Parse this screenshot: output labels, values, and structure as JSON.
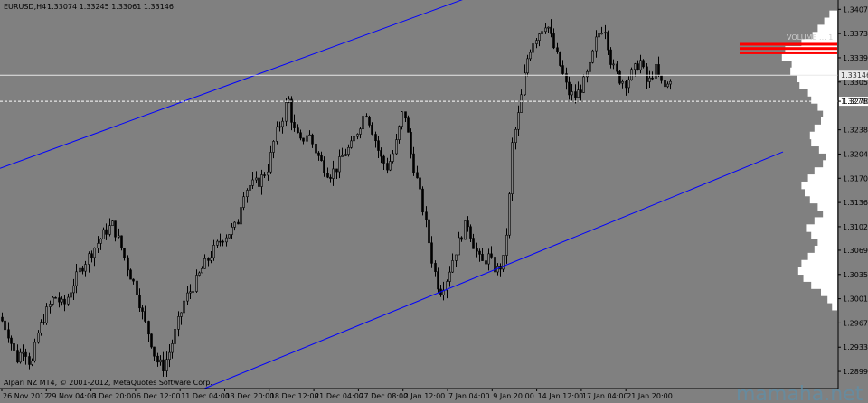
{
  "header": {
    "symbol": "EURUSD,H4",
    "ohlc": "1.33074 1.33245 1.33061 1.33146"
  },
  "copyright": "Alpari NZ MT4, © 2001-2012, MetaQuotes Software Corp.",
  "watermark": "mamaha.net",
  "colors": {
    "background": "#808080",
    "candle": "#000000",
    "channel": "#0000ff",
    "price_line": "#e8e8e8",
    "level_line": "#ffffff",
    "volume_profile": "#ffffff",
    "poc": "#ff0000",
    "axis_panel": "#808080"
  },
  "chart_data": {
    "type": "candlestick",
    "title": "",
    "xlabel": "",
    "ylabel": "",
    "ylim": [
      1.2875,
      1.3415
    ],
    "y_ticks": [
      "1.34070",
      "1.33730",
      "1.33390",
      "1.33050",
      "1.32780",
      "1.32380",
      "1.32040",
      "1.31700",
      "1.31360",
      "1.31020",
      "1.30690",
      "1.30350",
      "1.30010",
      "1.29670",
      "1.29330",
      "1.28990"
    ],
    "x_labels": [
      "26 Nov 2012",
      "29 Nov 04:00",
      "3 Dec 20:00",
      "6 Dec 12:00",
      "11 Dec 04:00",
      "13 Dec 20:00",
      "18 Dec 12:00",
      "21 Dec 04:00",
      "27 Dec 08:00",
      "2 Jan 12:00",
      "7 Jan 04:00",
      "9 Jan 20:00",
      "14 Jan 12:00",
      "17 Jan 04:00",
      "21 Jan 20:00"
    ],
    "current_price": 1.33146,
    "current_price_label": "1.33146",
    "level_price": 1.3278,
    "level_label": "1.32780",
    "poc_label": "VOLUME ... 1",
    "path": [
      [
        0,
        1.2975
      ],
      [
        8,
        1.2955
      ],
      [
        18,
        1.2915
      ],
      [
        26,
        1.2935
      ],
      [
        34,
        1.2905
      ],
      [
        42,
        1.2955
      ],
      [
        52,
        1.2985
      ],
      [
        60,
        1.3005
      ],
      [
        70,
        1.299
      ],
      [
        80,
        1.302
      ],
      [
        90,
        1.3045
      ],
      [
        100,
        1.3065
      ],
      [
        108,
        1.308
      ],
      [
        116,
        1.3095
      ],
      [
        124,
        1.3105
      ],
      [
        132,
        1.308
      ],
      [
        142,
        1.304
      ],
      [
        150,
        1.3015
      ],
      [
        158,
        1.2975
      ],
      [
        166,
        1.2945
      ],
      [
        172,
        1.2915
      ],
      [
        180,
        1.2905
      ],
      [
        188,
        1.293
      ],
      [
        196,
        1.2965
      ],
      [
        204,
        1.3
      ],
      [
        214,
        1.302
      ],
      [
        224,
        1.3045
      ],
      [
        234,
        1.3065
      ],
      [
        244,
        1.3085
      ],
      [
        254,
        1.3095
      ],
      [
        262,
        1.3105
      ],
      [
        268,
        1.315
      ],
      [
        276,
        1.316
      ],
      [
        286,
        1.3165
      ],
      [
        296,
        1.3185
      ],
      [
        304,
        1.323
      ],
      [
        312,
        1.3255
      ],
      [
        318,
        1.3285
      ],
      [
        324,
        1.324
      ],
      [
        332,
        1.322
      ],
      [
        340,
        1.3235
      ],
      [
        348,
        1.321
      ],
      [
        356,
        1.319
      ],
      [
        364,
        1.3175
      ],
      [
        372,
        1.3185
      ],
      [
        380,
        1.3205
      ],
      [
        388,
        1.3215
      ],
      [
        396,
        1.324
      ],
      [
        404,
        1.3265
      ],
      [
        412,
        1.3235
      ],
      [
        420,
        1.32
      ],
      [
        428,
        1.3185
      ],
      [
        436,
        1.321
      ],
      [
        446,
        1.327
      ],
      [
        454,
        1.3205
      ],
      [
        462,
        1.316
      ],
      [
        470,
        1.311
      ],
      [
        478,
        1.305
      ],
      [
        486,
        1.301
      ],
      [
        494,
        1.303
      ],
      [
        500,
        1.3055
      ],
      [
        508,
        1.3085
      ],
      [
        516,
        1.311
      ],
      [
        524,
        1.3075
      ],
      [
        532,
        1.305
      ],
      [
        540,
        1.306
      ],
      [
        548,
        1.304
      ],
      [
        556,
        1.305
      ],
      [
        562,
        1.312
      ],
      [
        566,
        1.3215
      ],
      [
        574,
        1.3265
      ],
      [
        582,
        1.3335
      ],
      [
        588,
        1.336
      ],
      [
        596,
        1.3375
      ],
      [
        604,
        1.339
      ],
      [
        612,
        1.3355
      ],
      [
        620,
        1.3325
      ],
      [
        628,
        1.329
      ],
      [
        636,
        1.3285
      ],
      [
        644,
        1.33
      ],
      [
        652,
        1.3325
      ],
      [
        660,
        1.337
      ],
      [
        668,
        1.3385
      ],
      [
        676,
        1.333
      ],
      [
        684,
        1.331
      ],
      [
        692,
        1.3305
      ],
      [
        700,
        1.332
      ],
      [
        708,
        1.3335
      ],
      [
        716,
        1.33
      ],
      [
        724,
        1.3325
      ],
      [
        730,
        1.3305
      ],
      [
        736,
        1.3295
      ],
      [
        742,
        1.3314
      ]
    ],
    "channel_upper": [
      [
        0,
        1.3184
      ],
      [
        560,
        1.3443
      ]
    ],
    "channel_lower": [
      [
        226,
        1.2875
      ],
      [
        866,
        1.3207
      ]
    ],
    "volume_profile": [
      [
        1.34,
        0.12
      ],
      [
        1.339,
        0.2
      ],
      [
        1.338,
        0.3
      ],
      [
        1.337,
        0.38
      ],
      [
        1.336,
        0.55
      ],
      [
        1.335,
        0.8
      ],
      [
        1.334,
        0.85
      ],
      [
        1.333,
        0.7
      ],
      [
        1.332,
        0.72
      ],
      [
        1.331,
        0.62
      ],
      [
        1.33,
        0.58
      ],
      [
        1.329,
        0.45
      ],
      [
        1.328,
        0.4
      ],
      [
        1.327,
        0.3
      ],
      [
        1.326,
        0.22
      ],
      [
        1.325,
        0.25
      ],
      [
        1.324,
        0.35
      ],
      [
        1.323,
        0.42
      ],
      [
        1.322,
        0.4
      ],
      [
        1.321,
        0.28
      ],
      [
        1.32,
        0.18
      ],
      [
        1.319,
        0.22
      ],
      [
        1.318,
        0.35
      ],
      [
        1.317,
        0.45
      ],
      [
        1.316,
        0.55
      ],
      [
        1.315,
        0.5
      ],
      [
        1.314,
        0.42
      ],
      [
        1.313,
        0.3
      ],
      [
        1.312,
        0.22
      ],
      [
        1.311,
        0.35
      ],
      [
        1.31,
        0.48
      ],
      [
        1.309,
        0.4
      ],
      [
        1.308,
        0.3
      ],
      [
        1.307,
        0.35
      ],
      [
        1.306,
        0.45
      ],
      [
        1.305,
        0.55
      ],
      [
        1.304,
        0.6
      ],
      [
        1.303,
        0.52
      ],
      [
        1.302,
        0.4
      ],
      [
        1.301,
        0.25
      ],
      [
        1.3,
        0.15
      ],
      [
        1.299,
        0.08
      ]
    ],
    "volume_poc": [
      1.3346,
      1.3352,
      1.3358
    ]
  }
}
